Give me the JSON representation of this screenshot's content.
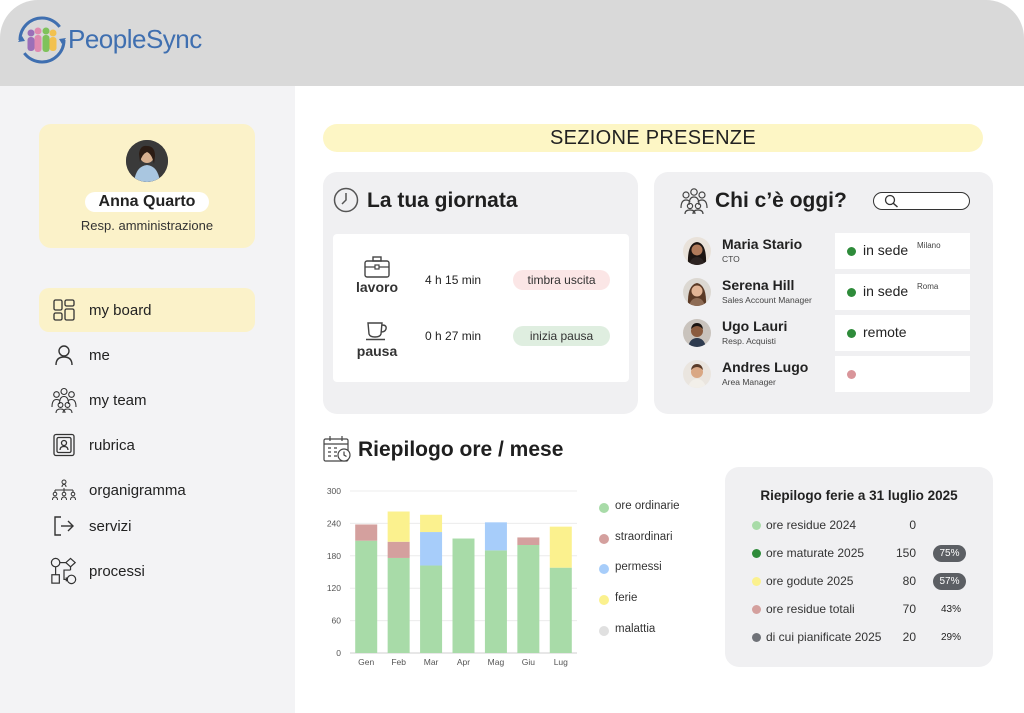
{
  "app": {
    "brand": "PeopleSync"
  },
  "user": {
    "name": "Anna Quarto",
    "role": "Resp. amministrazione"
  },
  "nav": [
    {
      "label": "my board",
      "icon": "dashboard-icon",
      "active": true
    },
    {
      "label": "me",
      "icon": "user-icon",
      "active": false
    },
    {
      "label": "my team",
      "icon": "team-icon",
      "active": false
    },
    {
      "label": "rubrica",
      "icon": "contacts-icon",
      "active": false
    },
    {
      "label": "organigramma",
      "icon": "org-chart-icon",
      "active": false
    },
    {
      "label": "servizi",
      "icon": "logout-arrow-icon",
      "active": false
    },
    {
      "label": "processi",
      "icon": "process-flow-icon",
      "active": false
    }
  ],
  "section_title": "SEZIONE PRESENZE",
  "giornata": {
    "title": "La tua giornata",
    "rows": [
      {
        "label": "lavoro",
        "icon": "briefcase-icon",
        "time": "4 h 15 min",
        "action": "timbra uscita",
        "action_color": "#fbe6e6"
      },
      {
        "label": "pausa",
        "icon": "coffee-cup-icon",
        "time": "0 h 27 min",
        "action": "inizia pausa",
        "action_color": "#dfeee0"
      }
    ]
  },
  "chi_oggi": {
    "title": "Chi c’è oggi?",
    "search_placeholder": "",
    "people": [
      {
        "name": "Maria Stario",
        "role": "CTO",
        "status": "in sede",
        "location": "Milano",
        "status_color": "#2e8b3a"
      },
      {
        "name": "Serena Hill",
        "role": "Sales Account Manager",
        "status": "in sede",
        "location": "Roma",
        "status_color": "#2e8b3a"
      },
      {
        "name": "Ugo Lauri",
        "role": "Resp. Acquisti",
        "status": "remote",
        "location": "",
        "status_color": "#2e8b3a"
      },
      {
        "name": "Andres Lugo",
        "role": "Area Manager",
        "status": "",
        "location": "",
        "status_color": "#d9959a"
      }
    ]
  },
  "riepilogo_title": "Riepilogo ore / mese",
  "chart_data": {
    "type": "bar",
    "stacked": true,
    "categories": [
      "Gen",
      "Feb",
      "Mar",
      "Apr",
      "Mag",
      "Giu",
      "Lug"
    ],
    "ylim": [
      0,
      300
    ],
    "yticks": [
      0,
      60,
      120,
      180,
      240,
      300
    ],
    "grid": true,
    "legend_position": "right",
    "series": [
      {
        "name": "ore ordinarie",
        "color": "#a8dba8",
        "values": [
          208,
          176,
          162,
          212,
          190,
          200,
          158
        ]
      },
      {
        "name": "straordinari",
        "color": "#d4a09e",
        "values": [
          30,
          30,
          0,
          0,
          0,
          14,
          0
        ]
      },
      {
        "name": "permessi",
        "color": "#a7cdfa",
        "values": [
          0,
          0,
          62,
          0,
          52,
          0,
          0
        ]
      },
      {
        "name": "ferie",
        "color": "#fbf18e",
        "values": [
          0,
          56,
          32,
          0,
          0,
          0,
          76
        ]
      },
      {
        "name": "malattia",
        "color": "#e0e0e0",
        "values": [
          0,
          0,
          0,
          0,
          0,
          0,
          0
        ]
      }
    ]
  },
  "ferie": {
    "title": "Riepilogo ferie a 31 luglio 2025",
    "rows": [
      {
        "label": "ore residue 2024",
        "value": "0",
        "pct": "",
        "dark": false,
        "color": "#a8dba8"
      },
      {
        "label": "ore maturate 2025",
        "value": "150",
        "pct": "75%",
        "dark": true,
        "color": "#2e8b3a"
      },
      {
        "label": "ore godute 2025",
        "value": "80",
        "pct": "57%",
        "dark": true,
        "color": "#fbf18e"
      },
      {
        "label": "ore residue totali",
        "value": "70",
        "pct": "43%",
        "dark": false,
        "color": "#d4a09e"
      },
      {
        "label": "di cui pianificate 2025",
        "value": "20",
        "pct": "29%",
        "dark": false,
        "color": "#6f7278"
      }
    ]
  }
}
